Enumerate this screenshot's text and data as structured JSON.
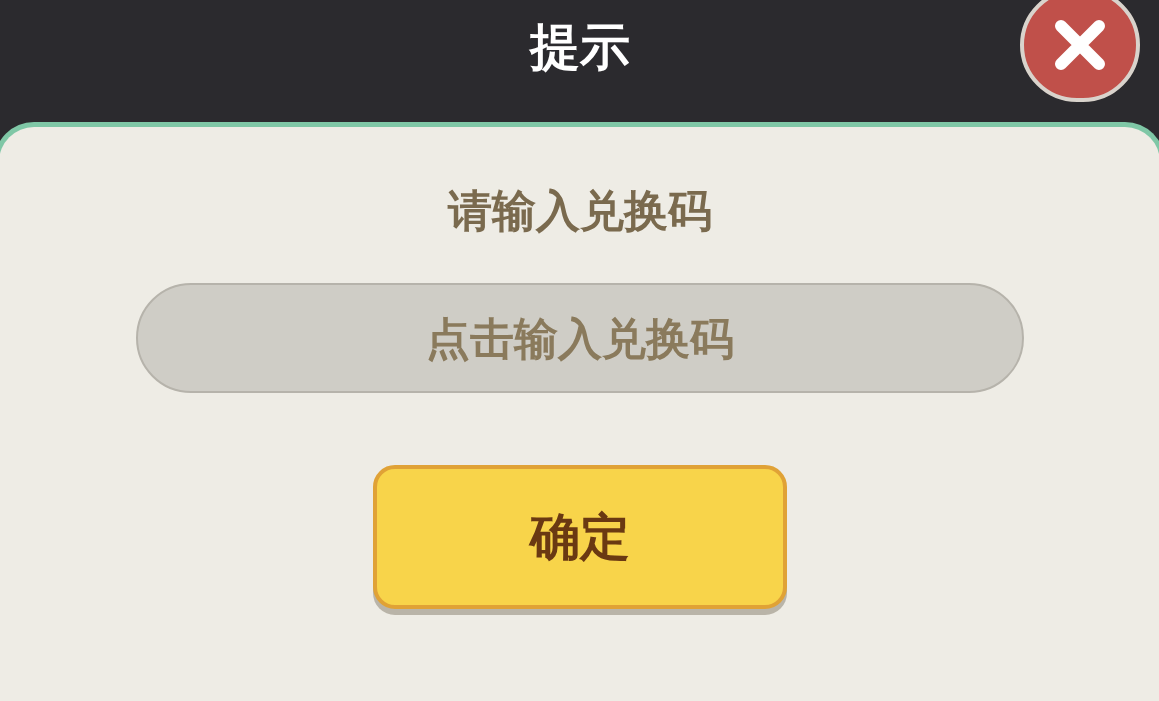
{
  "dialog": {
    "title": "提示",
    "prompt": "请输入兑换码",
    "field": {
      "placeholder": "点击输入兑换码"
    },
    "confirm_button": "确定"
  }
}
